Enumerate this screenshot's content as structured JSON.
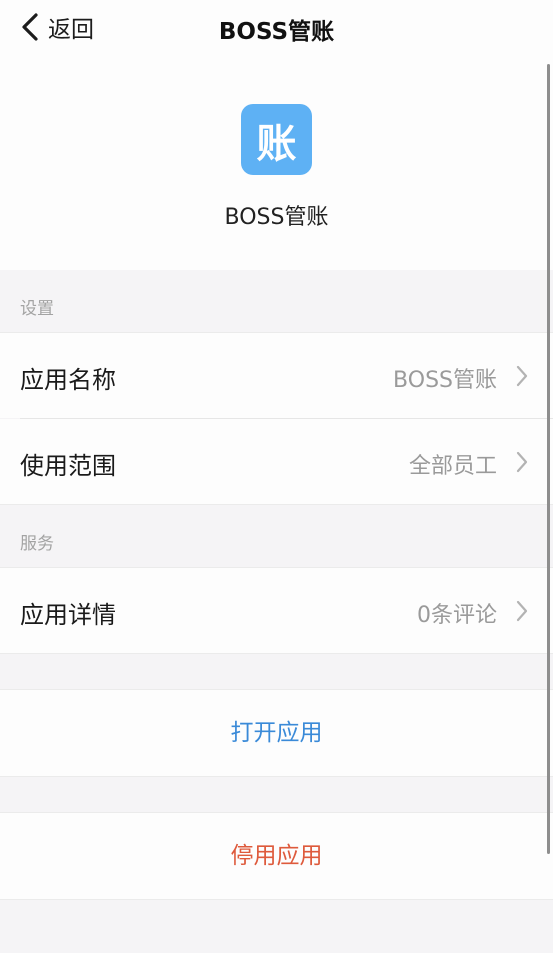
{
  "nav": {
    "back_label": "返回",
    "title": "BOSS管账"
  },
  "app": {
    "icon_glyph": "账",
    "icon_color": "#5eb1f4",
    "name": "BOSS管账"
  },
  "sections": {
    "settings": {
      "header": "设置",
      "items": [
        {
          "label": "应用名称",
          "value": "BOSS管账"
        },
        {
          "label": "使用范围",
          "value": "全部员工"
        }
      ]
    },
    "service": {
      "header": "服务",
      "items": [
        {
          "label": "应用详情",
          "value": "0条评论"
        }
      ]
    }
  },
  "actions": {
    "open_label": "打开应用",
    "open_color": "#3a8ad8",
    "disable_label": "停用应用",
    "disable_color": "#de5a3c"
  }
}
